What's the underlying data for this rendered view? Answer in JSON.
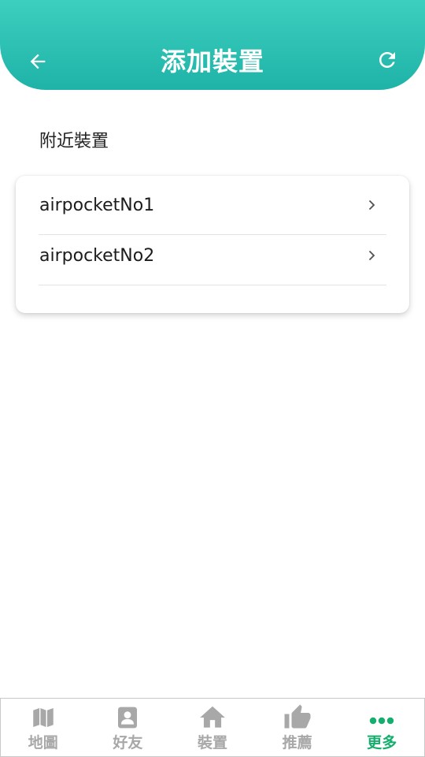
{
  "header": {
    "title": "添加裝置",
    "back_icon": "arrow-left-icon",
    "refresh_icon": "refresh-icon"
  },
  "section": {
    "label": "附近裝置"
  },
  "devices": [
    {
      "name": "airpocketNo1",
      "icon": "chevron-right-icon"
    },
    {
      "name": "airpocketNo2",
      "icon": "chevron-right-icon"
    }
  ],
  "tabbar": {
    "tabs": [
      {
        "label": "地圖",
        "icon": "map-icon",
        "active": false
      },
      {
        "label": "好友",
        "icon": "contact-icon",
        "active": false
      },
      {
        "label": "裝置",
        "icon": "home-icon",
        "active": false
      },
      {
        "label": "推薦",
        "icon": "thumbs-up-icon",
        "active": false
      },
      {
        "label": "更多",
        "icon": "more-icon",
        "active": true
      }
    ]
  },
  "colors": {
    "header_top": "#3ccfbf",
    "header_bottom": "#1fb3a8",
    "tab_inactive": "#a8a8a8",
    "tab_active": "#16ae6e"
  }
}
